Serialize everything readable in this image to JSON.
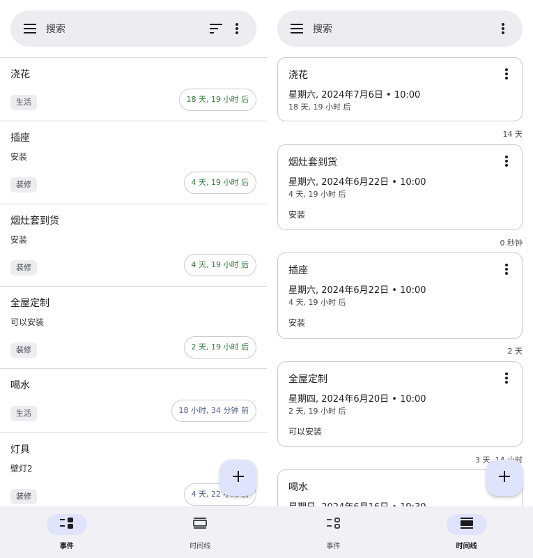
{
  "colors": {
    "search_bar_bg": "#ececf1",
    "bottom_nav_bg": "#f1f1f5",
    "active_indicator": "#dfe3fb",
    "future_time_text": "#2f7d3a",
    "past_time_text": "#4e5a8c",
    "tag_bg": "#ececf1"
  },
  "events_view": {
    "search": {
      "placeholder": "搜索",
      "menu_icon": "menu-icon",
      "sort_icon": "sort-icon",
      "more_icon": "more-vert-icon"
    },
    "events": [
      {
        "title": "浇花",
        "note": "",
        "tag": "生活",
        "relative": "18 天, 19 小时 后",
        "direction": "future"
      },
      {
        "title": "插座",
        "note": "安装",
        "tag": "装修",
        "relative": "4 天, 19 小时 后",
        "direction": "future"
      },
      {
        "title": "烟灶套到货",
        "note": "安装",
        "tag": "装修",
        "relative": "4 天, 19 小时 后",
        "direction": "future"
      },
      {
        "title": "全屋定制",
        "note": "可以安装",
        "tag": "装修",
        "relative": "2 天, 19 小时 后",
        "direction": "future"
      },
      {
        "title": "喝水",
        "note": "",
        "tag": "生活",
        "relative": "18 小时, 34 分钟 前",
        "direction": "past"
      },
      {
        "title": "灯具",
        "note": "壁灯2",
        "tag": "装修",
        "relative": "4 天, 22 小时 前",
        "direction": "past"
      }
    ],
    "fab_icon": "plus-icon"
  },
  "timeline_view": {
    "search": {
      "placeholder": "搜索",
      "menu_icon": "menu-icon",
      "more_icon": "more-vert-icon"
    },
    "cards": [
      {
        "title": "浇花",
        "date": "星期六, 2024年7月6日 • 10:00",
        "relative": "18 天, 19 小时 后",
        "note": ""
      },
      {
        "title": "烟灶套到货",
        "date": "星期六, 2024年6月22日 • 10:00",
        "relative": "4 天, 19 小时 后",
        "note": "安装"
      },
      {
        "title": "插座",
        "date": "星期六, 2024年6月22日 • 10:00",
        "relative": "4 天, 19 小时 后",
        "note": "安装"
      },
      {
        "title": "全屋定制",
        "date": "星期四, 2024年6月20日 • 10:00",
        "relative": "2 天, 19 小时 后",
        "note": "可以安装"
      },
      {
        "title": "喝水",
        "date": "星期日, 2024年6月16日 • 19:30",
        "relative": "",
        "note": ""
      }
    ],
    "gaps": [
      "14 天",
      "0 秒钟",
      "2 天",
      "3 天, 14 小时"
    ],
    "fab_icon": "plus-icon"
  },
  "bottom_nav": {
    "items": [
      {
        "label": "事件",
        "icon": "events-icon"
      },
      {
        "label": "时间线",
        "icon": "timeline-icon"
      }
    ]
  }
}
